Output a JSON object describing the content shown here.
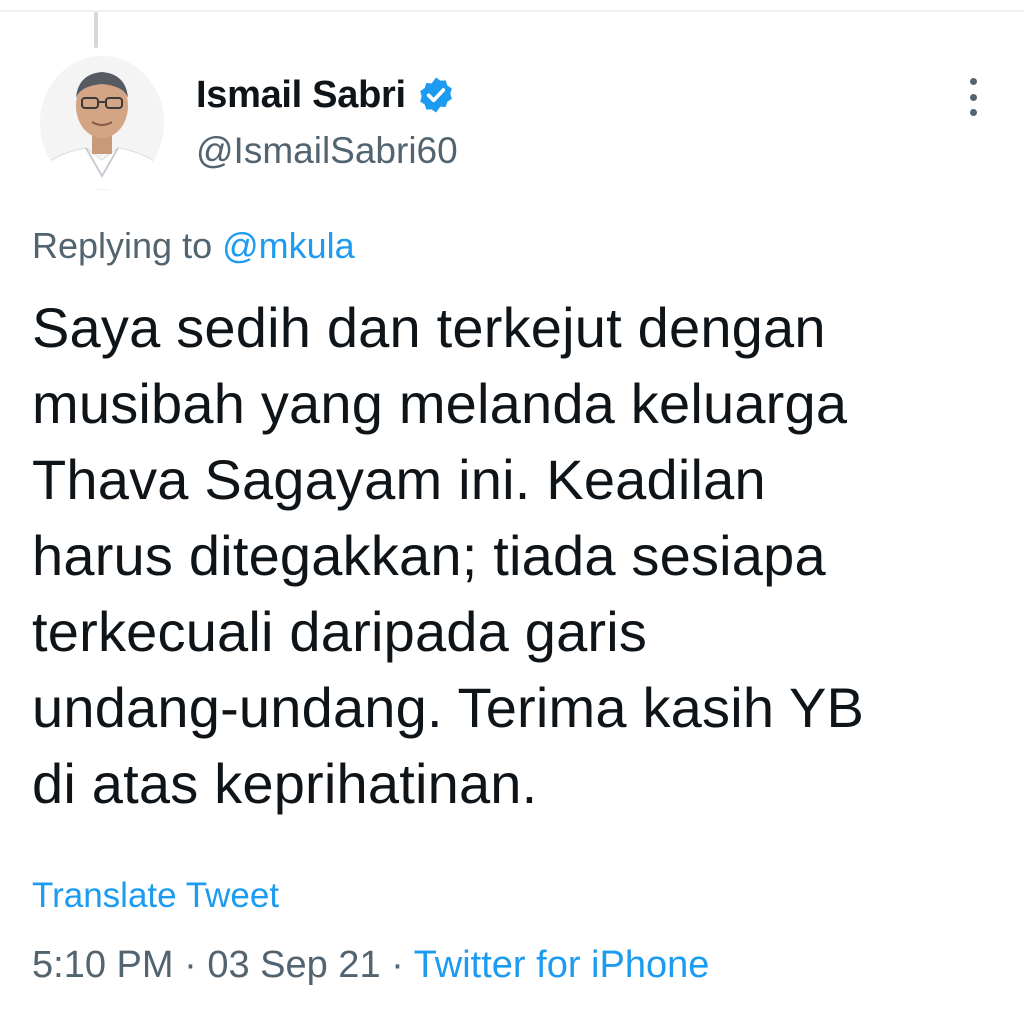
{
  "tweet": {
    "author": {
      "display_name": "Ismail Sabri",
      "handle": "@IsmailSabri60",
      "verified_icon": "verified-badge-icon",
      "avatar": "avatar-photo"
    },
    "replying_prefix": "Replying to",
    "replying_to": "@mkula",
    "text_lines": [
      "Saya sedih dan terkejut dengan",
      "musibah yang melanda keluarga",
      "Thava Sagayam ini. Keadilan",
      "harus ditegakkan; tiada sesiapa",
      "terkecuali daripada garis",
      "undang-undang. Terima kasih YB",
      "di atas keprihatinan."
    ],
    "translate_label": "Translate Tweet",
    "time": "5:10 PM",
    "separator": "·",
    "date": "03 Sep 21",
    "source": "Twitter for iPhone"
  },
  "colors": {
    "accent": "#1d9bf0",
    "text": "#0f1419",
    "secondary": "#536471"
  }
}
